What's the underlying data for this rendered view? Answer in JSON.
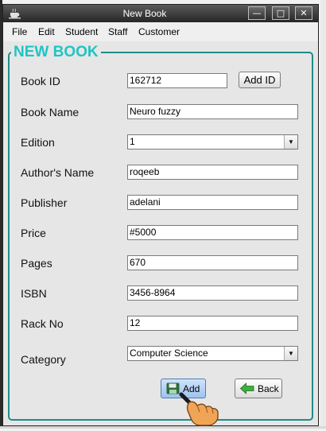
{
  "window": {
    "title": "New Book",
    "controls": {
      "minimize": "—",
      "maximize": "□",
      "close": "✕"
    }
  },
  "menu": {
    "items": [
      "File",
      "Edit",
      "Student",
      "Staff",
      "Customer"
    ]
  },
  "form": {
    "heading": "NEW BOOK",
    "fields": [
      {
        "label": "Book ID",
        "value": "162712"
      },
      {
        "label": "Book Name",
        "value": "Neuro fuzzy"
      },
      {
        "label": "Edition",
        "value": "1",
        "type": "select"
      },
      {
        "label": "Author's Name",
        "value": "roqeeb"
      },
      {
        "label": "Publisher",
        "value": "adelani"
      },
      {
        "label": "Price",
        "value": "#5000"
      },
      {
        "label": "Pages",
        "value": "670"
      },
      {
        "label": "ISBN",
        "value": "3456-8964"
      },
      {
        "label": "Rack No",
        "value": "12"
      },
      {
        "label": "Category",
        "value": "Computer Science",
        "type": "select"
      }
    ],
    "add_id_button": "Add ID",
    "add_button": "Add",
    "back_button": "Back"
  },
  "icons": {
    "app": "teacup-icon",
    "add": "floppy-disk-icon",
    "back": "green-back-arrow-icon",
    "cursor": "hand-pointer-icon"
  },
  "colors": {
    "title_bar": "#333333",
    "heading": "#20c4c4",
    "group_border": "#1e8c8a"
  }
}
